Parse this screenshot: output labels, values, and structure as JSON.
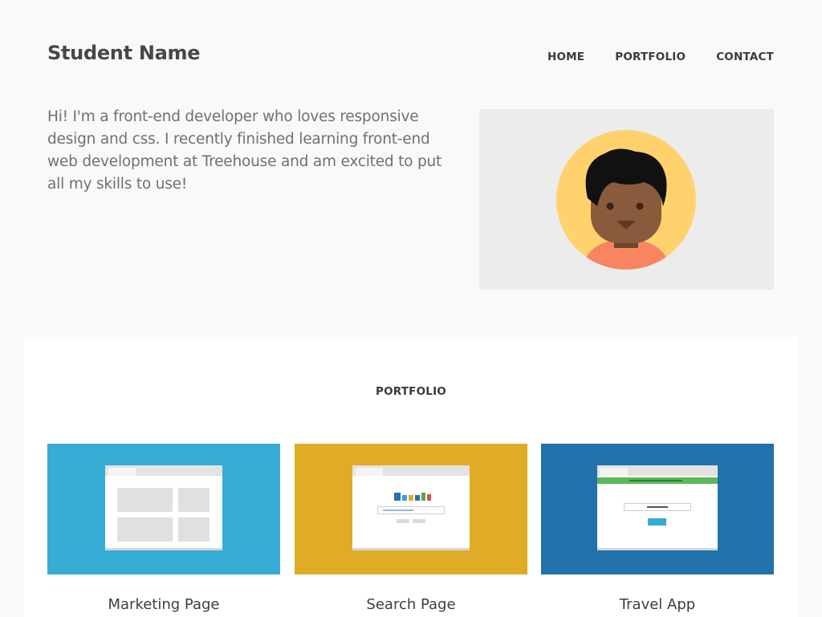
{
  "header": {
    "site_title": "Student Name",
    "nav": [
      "HOME",
      "PORTFOLIO",
      "CONTACT"
    ]
  },
  "intro": {
    "text": "Hi! I'm a front-end developer who loves responsive design and css. I recently finished learning front-end web development at Treehouse and am excited to put all my skills to use!"
  },
  "portfolio": {
    "heading": "PORTFOLIO",
    "items": [
      {
        "caption": "Marketing Page",
        "color": "#36acd4"
      },
      {
        "caption": "Search Page",
        "color": "#e0ac28"
      },
      {
        "caption": "Travel App",
        "color": "#2172aa"
      }
    ]
  },
  "colors": {
    "background": "#f9f9f9",
    "avatar_bg": "#ececec",
    "avatar_circle": "#ffd26e",
    "skin": "#8a5a3c",
    "shirt": "#f8855f"
  }
}
